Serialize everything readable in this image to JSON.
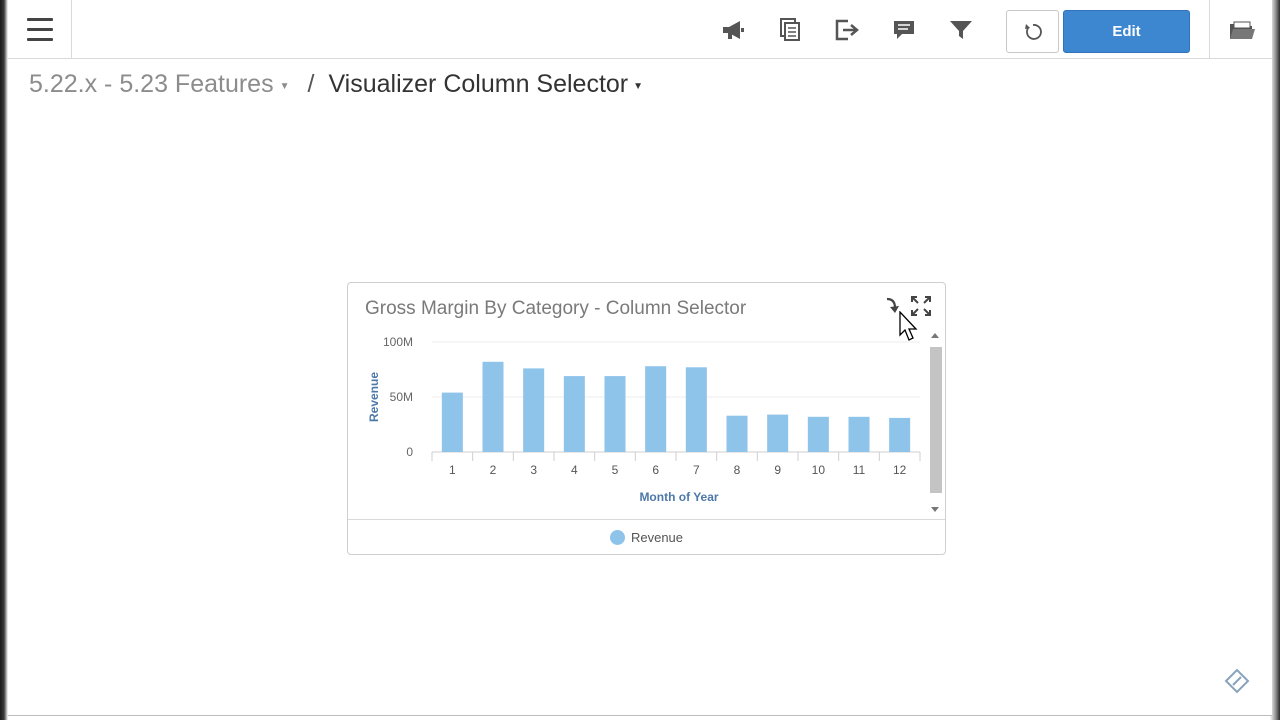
{
  "toolbar": {
    "icons": [
      "megaphone-icon",
      "copy-document-icon",
      "export-icon",
      "comment-icon",
      "filter-icon",
      "refresh-icon",
      "folder-icon"
    ],
    "edit_label": "Edit"
  },
  "breadcrumb": {
    "parent": "5.22.x - 5.23 Features",
    "separator": "/",
    "current": "Visualizer Column Selector"
  },
  "widget": {
    "title": "Gross Margin By Category - Column Selector",
    "legend_label": "Revenue"
  },
  "colors": {
    "accent": "#3d86d0",
    "bar": "#8ec3ea",
    "axis_title": "#4d79a8"
  },
  "chart_data": {
    "type": "bar",
    "categories": [
      "1",
      "2",
      "3",
      "4",
      "5",
      "6",
      "7",
      "8",
      "9",
      "10",
      "11",
      "12"
    ],
    "series": [
      {
        "name": "Revenue",
        "values": [
          54,
          82,
          76,
          69,
          69,
          78,
          77,
          33,
          34,
          32,
          32,
          31
        ]
      }
    ],
    "value_unit": "M",
    "xlabel": "Month of Year",
    "ylabel": "Revenue",
    "ylim": [
      0,
      100
    ],
    "yticks": [
      "0",
      "50M",
      "100M"
    ],
    "grid": true,
    "legend_position": "bottom"
  }
}
